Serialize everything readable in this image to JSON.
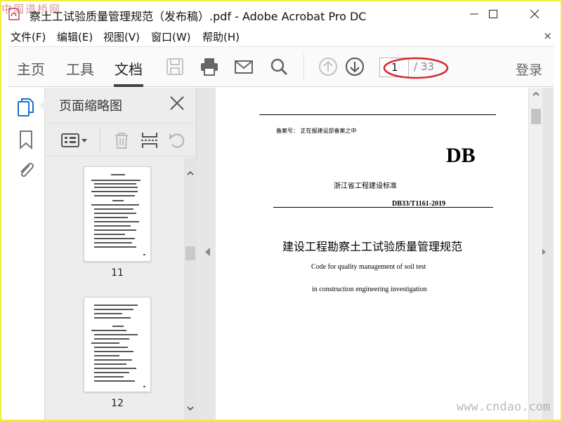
{
  "watermarks": {
    "top_left": "中国道桥网",
    "bottom_right": "www.cndao.com"
  },
  "window": {
    "title": "察土工试验质量管理规范（发布稿）.pdf - Adobe Acrobat Pro DC",
    "minimize_icon": "minimize-icon",
    "maximize_icon": "maximize-icon",
    "close_icon": "close-icon"
  },
  "menu": {
    "items": [
      "文件(F)",
      "编辑(E)",
      "视图(V)",
      "窗口(W)",
      "帮助(H)"
    ],
    "close": "×"
  },
  "toolbar": {
    "tabs": [
      "主页",
      "工具",
      "文档"
    ],
    "active_tab": "文档",
    "icons": [
      "save-icon",
      "print-icon",
      "email-icon",
      "search-icon",
      "page-up-icon",
      "page-down-icon"
    ],
    "page_current": "1",
    "page_total": "/ 33",
    "login": "登录",
    "highlight_color": "#d9262b"
  },
  "rail": {
    "icons": [
      "page-thumbnails-icon",
      "bookmark-icon",
      "attachment-icon"
    ],
    "accent": "#1a73c8"
  },
  "thumbnails_panel": {
    "title": "页面缩略图",
    "tools": [
      "options-menu-icon",
      "delete-icon",
      "insert-page-icon",
      "rotate-icon"
    ],
    "pages": [
      {
        "label": "11"
      },
      {
        "label": "12"
      }
    ]
  },
  "document": {
    "filing": "备案号：  正在报建设部备案之中",
    "logo": "DB",
    "standard_name": "浙江省工程建设标准",
    "standard_code": "DB33/T1161-2019",
    "title_cn": "建设工程勘察土工试验质量管理规范",
    "title_en_line1": "Code for quality management of soil test",
    "title_en_line2": "in construction engineering investigation"
  }
}
